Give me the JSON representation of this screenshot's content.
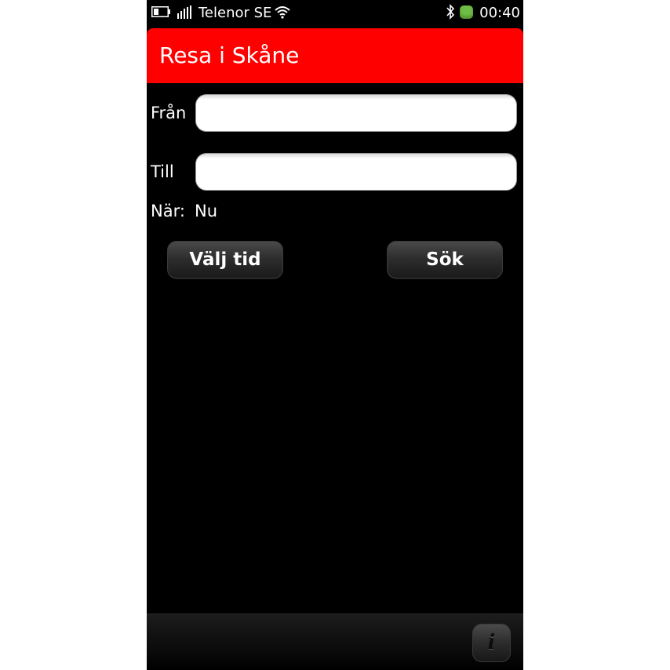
{
  "status_bar": {
    "carrier": "Telenor SE",
    "time": "00:40",
    "icons": [
      "battery-icon",
      "signal-strength-icon",
      "wifi-icon",
      "bluetooth-icon",
      "status-indicator-icon"
    ],
    "indicator_color": "#6dbe45"
  },
  "header": {
    "title": "Resa i Skåne",
    "background_color": "#ff0000"
  },
  "form": {
    "from_label": "Från",
    "from_value": "",
    "to_label": "Till",
    "to_value": "",
    "when_label": "När:",
    "when_value": "Nu"
  },
  "buttons": {
    "choose_time_label": "Välj tid",
    "search_label": "Sök"
  },
  "toolbar": {
    "info_icon": "info-icon",
    "info_glyph": "i"
  }
}
